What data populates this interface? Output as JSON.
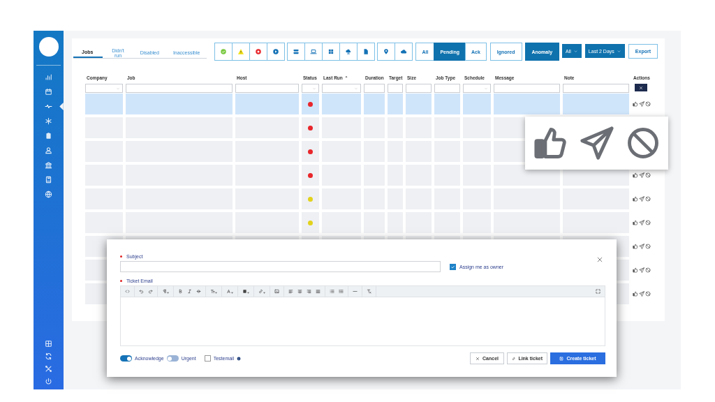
{
  "sidebar": {
    "items": [
      {
        "selected": false
      },
      {
        "selected": false
      },
      {
        "selected": true
      },
      {
        "selected": false
      },
      {
        "selected": false
      },
      {
        "selected": false
      },
      {
        "selected": false
      },
      {
        "selected": false
      },
      {
        "selected": false
      }
    ]
  },
  "tabs": [
    {
      "label": "Jobs",
      "selected": true
    },
    {
      "label": "Didn't run",
      "selected": false
    },
    {
      "label": "Disabled",
      "selected": false
    },
    {
      "label": "Inaccessible",
      "selected": false
    }
  ],
  "segment": [
    {
      "label": "All",
      "selected": false
    },
    {
      "label": "Pending",
      "selected": true
    },
    {
      "label": "Ack",
      "selected": false
    }
  ],
  "buttons": [
    {
      "label": "Ignored",
      "selected": false
    },
    {
      "label": "Anomaly",
      "selected": true
    }
  ],
  "dropdowns": [
    {
      "value": "All"
    },
    {
      "value": "Last 2 Days"
    }
  ],
  "export_button": "Export",
  "table": {
    "columns": [
      {
        "label": "Company",
        "kind": "select"
      },
      {
        "label": "Job",
        "kind": "input"
      },
      {
        "label": "Host",
        "kind": "input"
      },
      {
        "label": "Status",
        "kind": "select"
      },
      {
        "label": "Last Run",
        "kind": "select",
        "sorted": true
      },
      {
        "label": "Duration",
        "kind": "input"
      },
      {
        "label": "Target",
        "kind": "input"
      },
      {
        "label": "Size",
        "kind": "input"
      },
      {
        "label": "Job Type",
        "kind": "input"
      },
      {
        "label": "Schedule",
        "kind": "select"
      },
      {
        "label": "Message",
        "kind": "input"
      },
      {
        "label": "Note",
        "kind": "input"
      },
      {
        "label": "Actions",
        "kind": "clear"
      }
    ],
    "rows": [
      {
        "selected": true,
        "color": "#e8262b"
      },
      {
        "selected": false,
        "color": "#e8262b"
      },
      {
        "selected": false,
        "color": "#e8262b"
      },
      {
        "selected": false,
        "color": "#e8262b"
      },
      {
        "selected": false,
        "color": "#e2d21c"
      },
      {
        "selected": false,
        "color": "#e2d21c"
      },
      {
        "selected": false
      },
      {
        "selected": false
      },
      {
        "selected": false
      }
    ]
  },
  "ticket_dialog": {
    "subject_label": "Subject",
    "assign_owner": {
      "label": "Assign me as owner",
      "checked": true
    },
    "email_label": "Ticket Email",
    "acknowledge": {
      "label": "Acknowledge",
      "on": true
    },
    "urgent": {
      "label": "Urgent",
      "on": false
    },
    "testemail": {
      "label": "Testemail",
      "checked": false
    },
    "buttons": [
      {
        "label": "Cancel",
        "kind": "cancel"
      },
      {
        "label": "Link ticket",
        "kind": "link"
      },
      {
        "label": "Create ticket",
        "kind": "create"
      }
    ]
  }
}
